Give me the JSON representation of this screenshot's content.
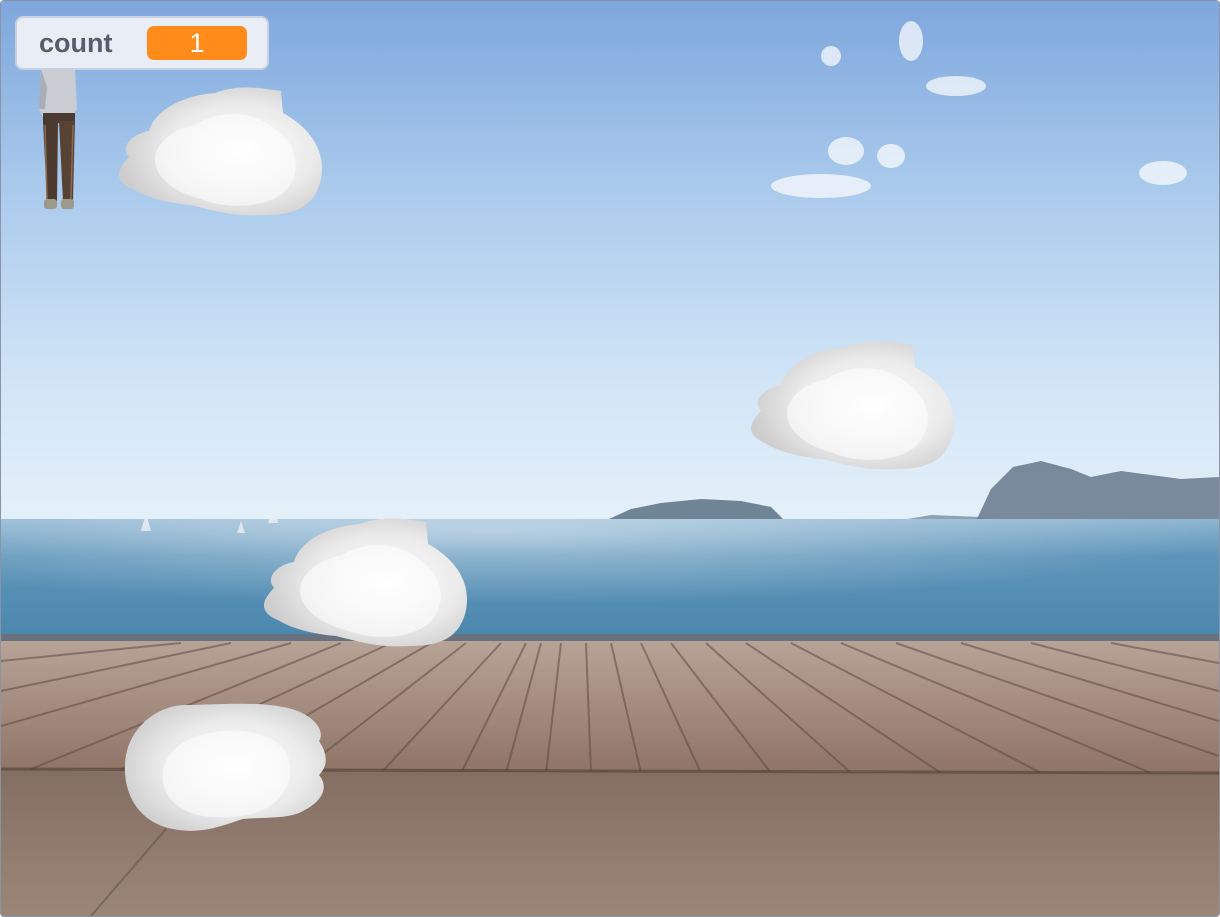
{
  "monitor": {
    "label": "count",
    "value": "1",
    "value_color": "#ff8c1a"
  },
  "colors": {
    "sky_top": "#7fa8de",
    "sky_bottom": "#d7eaf8",
    "sea": "#5a8fb2",
    "deck": "#9a8073",
    "ground": "#8e7a6c"
  },
  "sprites": {
    "player": "person-sprite",
    "clouds": [
      "cloud-sprite",
      "cloud-sprite",
      "cloud-sprite",
      "cloud-sprite"
    ]
  }
}
